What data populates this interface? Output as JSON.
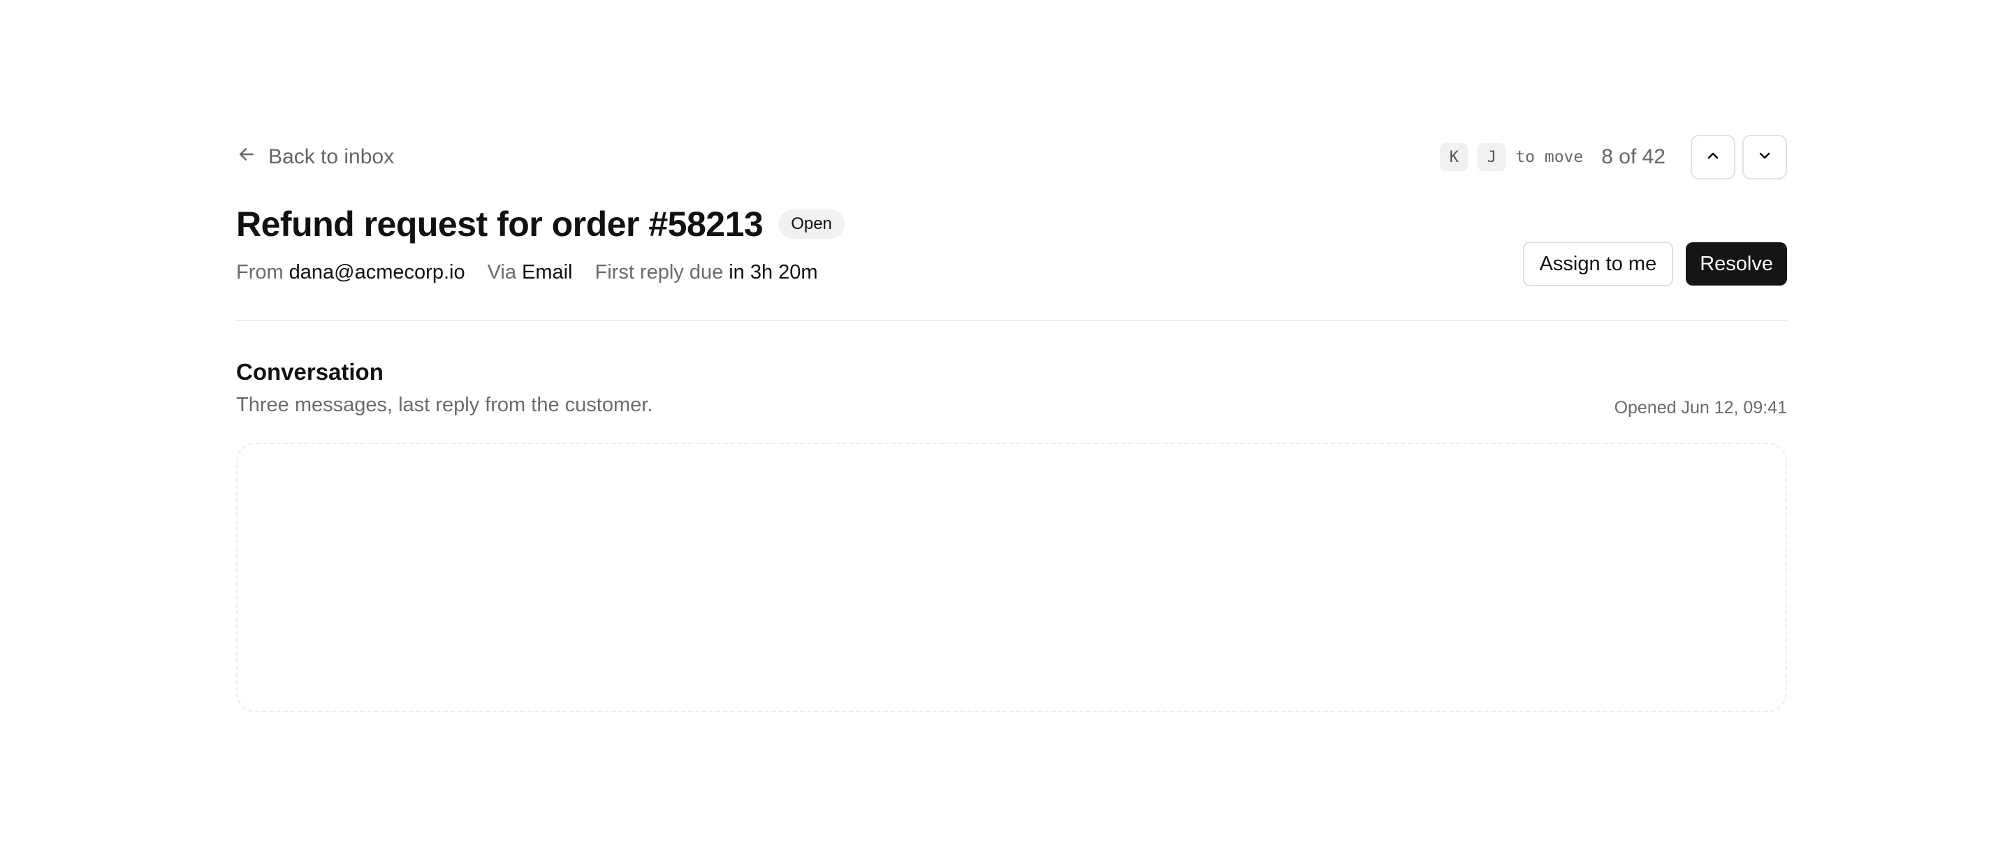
{
  "nav": {
    "back_label": "Back to inbox",
    "shortcut_keys": [
      "K",
      "J"
    ],
    "shortcut_hint": "to move",
    "position": "8 of 42"
  },
  "ticket": {
    "title": "Refund request for order #58213",
    "status": "Open",
    "from_label": "From",
    "from_value": "dana@acmecorp.io",
    "via_label": "Via",
    "via_value": "Email",
    "due_label": "First reply due",
    "due_value": "in 3h 20m"
  },
  "actions": {
    "assign_label": "Assign to me",
    "resolve_label": "Resolve"
  },
  "conversation": {
    "title": "Conversation",
    "subtitle": "Three messages, last reply from the customer.",
    "opened": "Opened Jun 12, 09:41"
  },
  "icons": {
    "back": "arrow-left-icon",
    "prev": "chevron-up-icon",
    "next": "chevron-down-icon"
  },
  "colors": {
    "primary_button": "#151515",
    "muted_text": "#6b6b6b",
    "badge_bg": "#f1f1f1"
  }
}
